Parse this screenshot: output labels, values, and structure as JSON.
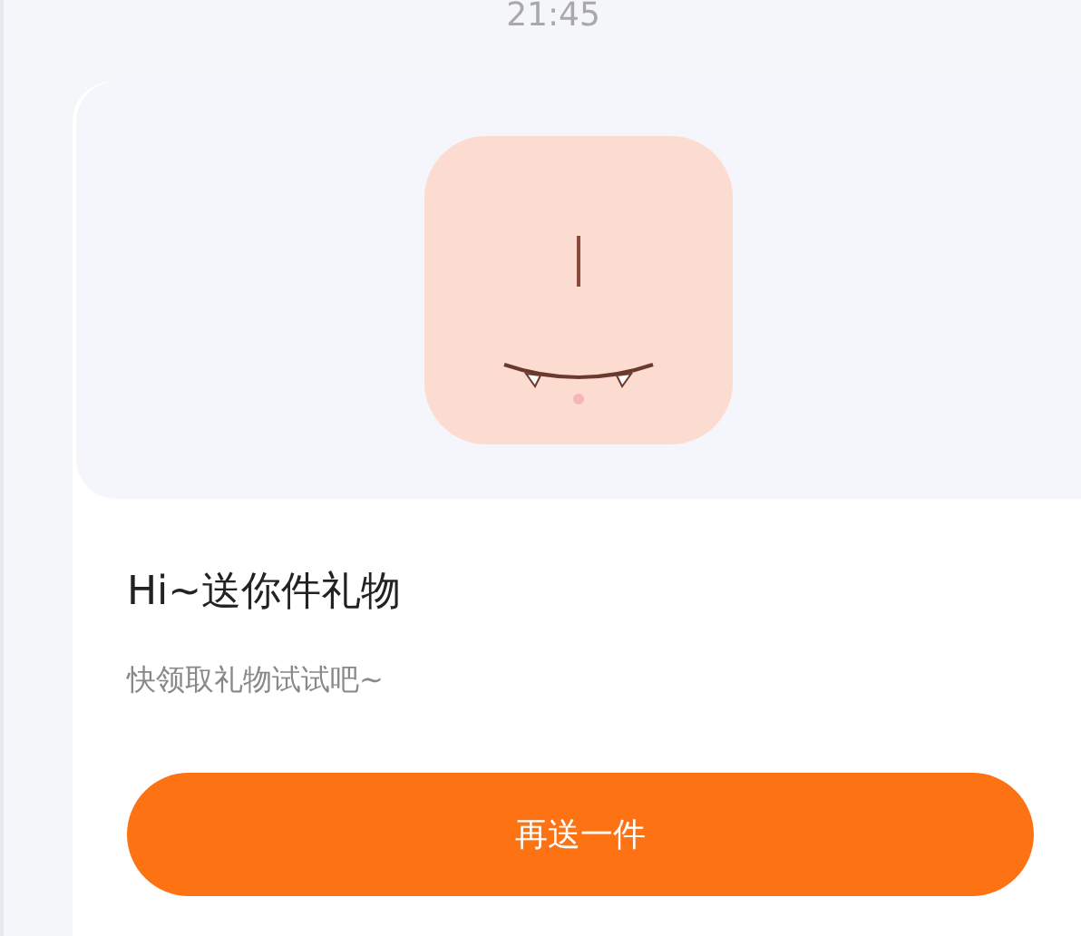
{
  "timestamp": "21:45",
  "gift_card": {
    "title": "Hi~送你件礼物",
    "subtitle": "快领取礼物试试吧~",
    "button": "再送一件"
  }
}
